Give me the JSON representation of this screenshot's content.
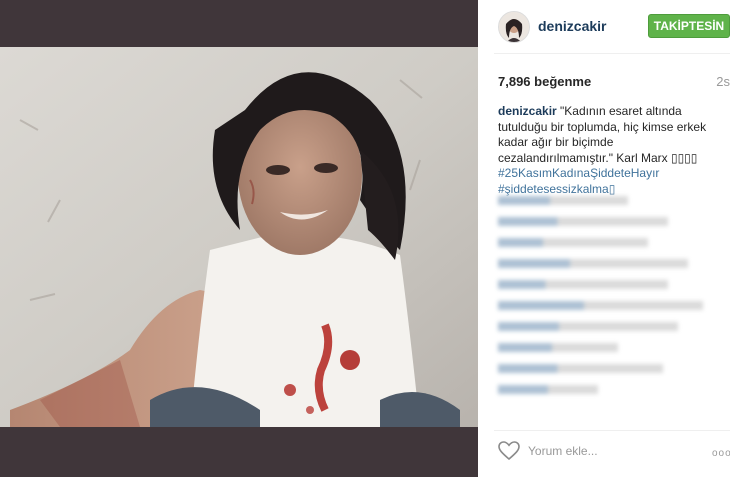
{
  "post": {
    "username": "denizcakir",
    "follow_label": "TAKİPTESİN",
    "likes": "7,896 beğenme",
    "time_ago": "2s",
    "caption": {
      "username": "denizcakir",
      "text": "\"Kadının esaret altında tutulduğu bir toplumda, hiç kimse erkek kadar ağır bir biçimde cezalandırılmamıştır.\" Karl Marx ▯▯▯▯",
      "hashtags": [
        "#25KasımKadınaŞiddeteHayır",
        "#şiddetesessizkalma▯"
      ]
    },
    "comment_placeholder": "Yorum ekle...",
    "more_label": "ooo"
  },
  "icons": {
    "like": "heart-outline-icon",
    "more": "more-options-icon"
  },
  "colors": {
    "follow_button": "#5fb34a",
    "username": "#1c3b5a",
    "hashtag": "#3f729b"
  }
}
